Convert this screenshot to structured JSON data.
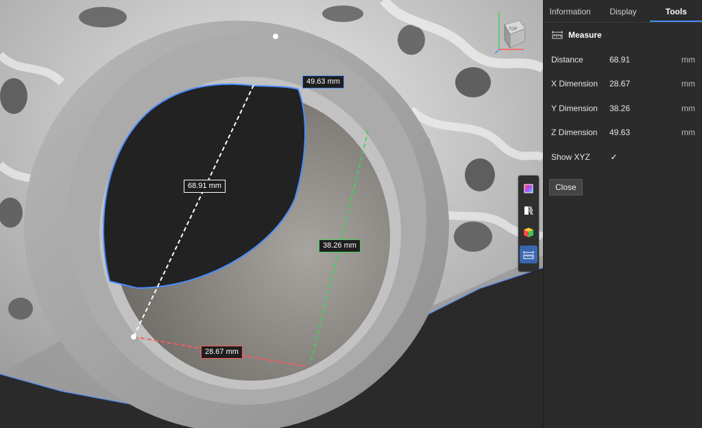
{
  "viewport": {
    "labels": {
      "z_dim": "49.63 mm",
      "distance": "68.91 mm",
      "y_dim": "38.26 mm",
      "x_dim": "28.67 mm"
    },
    "nav_cube_face": "TOP",
    "axis_letter": "Y",
    "toolstrip": [
      {
        "icon": "color-map-icon",
        "active": false
      },
      {
        "icon": "section-view-icon",
        "active": false
      },
      {
        "icon": "cube-icon",
        "active": false
      },
      {
        "icon": "ruler-measure-icon",
        "active": true
      }
    ]
  },
  "panel": {
    "tabs": [
      {
        "label": "Information",
        "active": false
      },
      {
        "label": "Display",
        "active": false
      },
      {
        "label": "Tools",
        "active": true
      }
    ],
    "measure": {
      "title": "Measure",
      "rows": [
        {
          "label": "Distance",
          "value": "68.91",
          "unit": "mm"
        },
        {
          "label": "X Dimension",
          "value": "28.67",
          "unit": "mm"
        },
        {
          "label": "Y Dimension",
          "value": "38.26",
          "unit": "mm"
        },
        {
          "label": "Z Dimension",
          "value": "49.63",
          "unit": "mm"
        }
      ],
      "show_xyz_label": "Show XYZ",
      "show_xyz_checked": true,
      "check_glyph": "✓",
      "close_label": "Close"
    }
  },
  "colors": {
    "accent": "#4a8cff",
    "x_axis": "#ff5a5a",
    "y_axis": "#3fd35a",
    "z_axis": "#4a8cff"
  }
}
